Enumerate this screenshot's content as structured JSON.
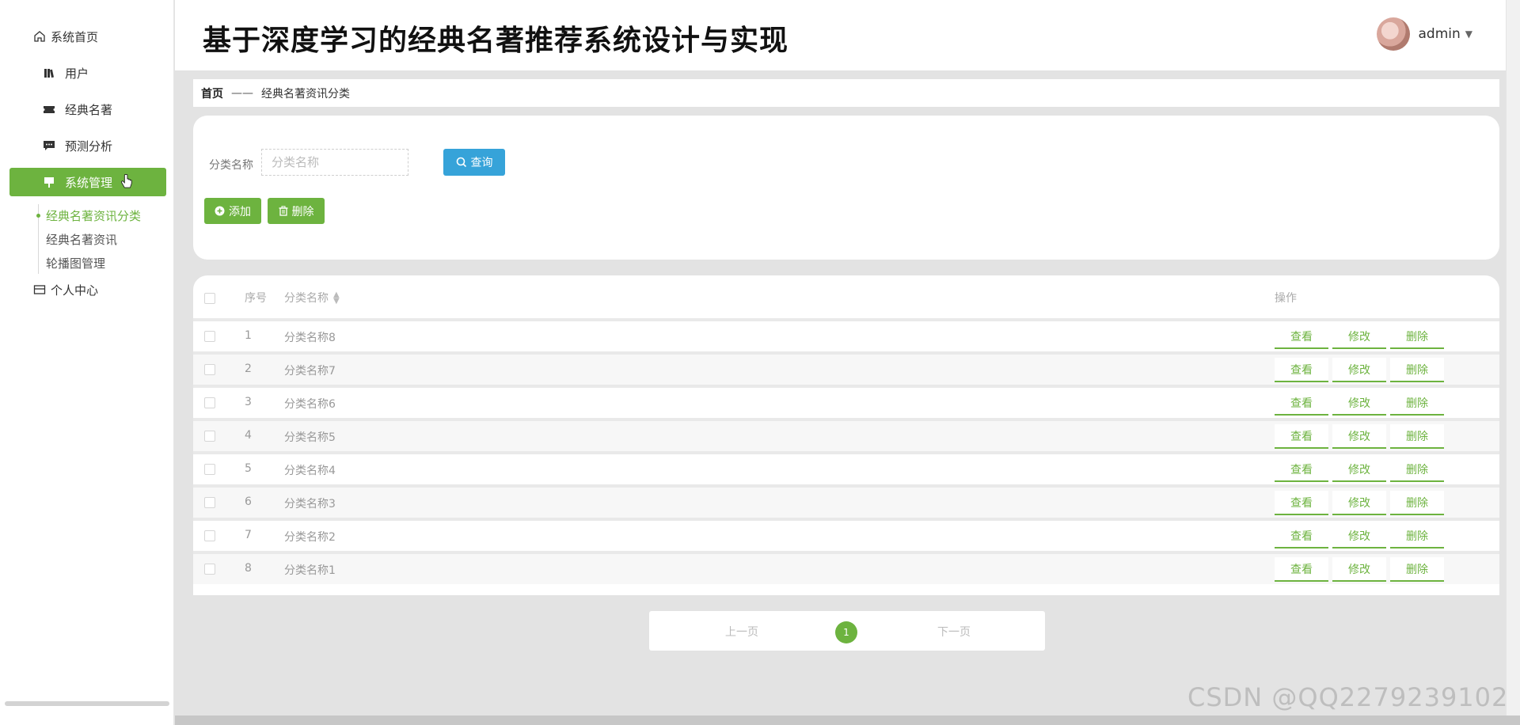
{
  "app_title": "基于深度学习的经典名著推荐系统设计与实现",
  "user": {
    "name": "admin"
  },
  "sidebar": {
    "items": [
      {
        "label": "系统首页",
        "icon": "home-icon"
      },
      {
        "label": "用户",
        "icon": "books-icon"
      },
      {
        "label": "经典名著",
        "icon": "ticket-icon"
      },
      {
        "label": "预测分析",
        "icon": "chat-icon"
      },
      {
        "label": "系统管理",
        "icon": "board-icon",
        "active": true
      },
      {
        "label": "个人中心",
        "icon": "card-icon"
      }
    ],
    "submenu": [
      {
        "label": "经典名著资讯分类",
        "active": true
      },
      {
        "label": "经典名著资讯"
      },
      {
        "label": "轮播图管理"
      }
    ]
  },
  "breadcrumb": {
    "home": "首页",
    "separator": "——",
    "current": "经典名著资讯分类"
  },
  "search": {
    "label": "分类名称",
    "placeholder": "分类名称",
    "query_button": "查询"
  },
  "actions": {
    "add": "添加",
    "delete": "删除"
  },
  "table": {
    "headers": {
      "index": "序号",
      "name": "分类名称",
      "ops": "操作"
    },
    "rows": [
      {
        "index": "1",
        "name": "分类名称8"
      },
      {
        "index": "2",
        "name": "分类名称7"
      },
      {
        "index": "3",
        "name": "分类名称6"
      },
      {
        "index": "4",
        "name": "分类名称5"
      },
      {
        "index": "5",
        "name": "分类名称4"
      },
      {
        "index": "6",
        "name": "分类名称3"
      },
      {
        "index": "7",
        "name": "分类名称2"
      },
      {
        "index": "8",
        "name": "分类名称1"
      }
    ],
    "row_actions": {
      "view": "查看",
      "edit": "修改",
      "delete": "删除"
    }
  },
  "pagination": {
    "prev": "上一页",
    "current": "1",
    "next": "下一页"
  },
  "watermark": "CSDN @QQ2279239102",
  "colors": {
    "primary": "#6db33f",
    "query": "#36a3d9"
  }
}
